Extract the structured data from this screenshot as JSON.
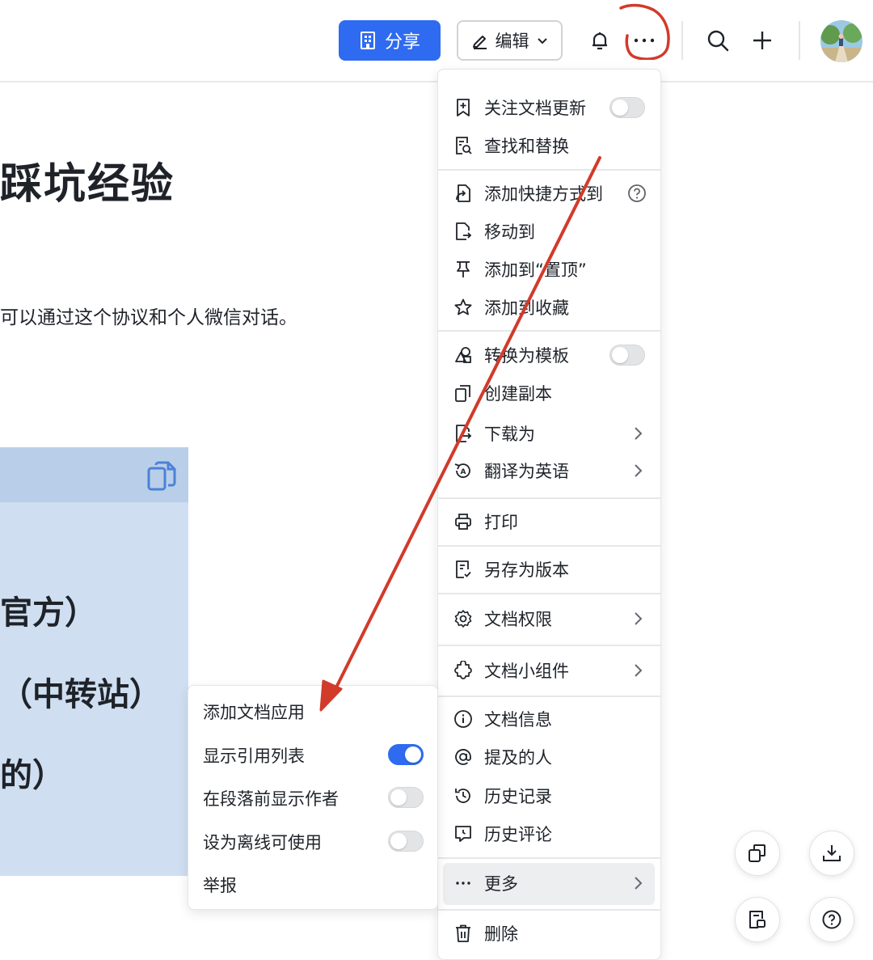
{
  "header": {
    "share_label": "分享",
    "edit_label": "编辑"
  },
  "document": {
    "title": "踩坑经验",
    "paragraph": "可以通过这个协议和个人微信对话。",
    "code_lines": [
      "官方）",
      "（中转站）",
      "的）"
    ]
  },
  "menu": {
    "items": [
      {
        "label": "关注文档更新",
        "icon": "follow-doc-icon",
        "toggle": false
      },
      {
        "label": "查找和替换",
        "icon": "find-replace-icon"
      },
      {
        "label": "添加快捷方式到",
        "icon": "shortcut-icon",
        "help": true
      },
      {
        "label": "移动到",
        "icon": "move-icon"
      },
      {
        "label": "添加到“置顶”",
        "icon": "pin-icon"
      },
      {
        "label": "添加到收藏",
        "icon": "star-icon"
      },
      {
        "label": "转换为模板",
        "icon": "template-icon",
        "toggle": false
      },
      {
        "label": "创建副本",
        "icon": "copy-icon"
      },
      {
        "label": "下载为",
        "icon": "download-as-icon",
        "submenu": true
      },
      {
        "label": "翻译为英语",
        "icon": "translate-icon",
        "submenu": true
      },
      {
        "label": "打印",
        "icon": "print-icon"
      },
      {
        "label": "另存为版本",
        "icon": "save-version-icon"
      },
      {
        "label": "文档权限",
        "icon": "settings-icon",
        "submenu": true
      },
      {
        "label": "文档小组件",
        "icon": "widget-icon",
        "submenu": true
      },
      {
        "label": "文档信息",
        "icon": "info-icon"
      },
      {
        "label": "提及的人",
        "icon": "at-icon"
      },
      {
        "label": "历史记录",
        "icon": "history-icon"
      },
      {
        "label": "历史评论",
        "icon": "comment-history-icon"
      },
      {
        "label": "更多",
        "icon": "ellipsis-icon",
        "submenu": true,
        "highlighted": true
      },
      {
        "label": "删除",
        "icon": "trash-icon"
      }
    ]
  },
  "submenu": {
    "items": [
      {
        "label": "添加文档应用"
      },
      {
        "label": "显示引用列表",
        "toggle": true
      },
      {
        "label": "在段落前显示作者",
        "toggle": false
      },
      {
        "label": "设为离线可使用",
        "toggle": false
      },
      {
        "label": "举报"
      }
    ]
  },
  "colors": {
    "accent": "#2f6bf0",
    "annotation_red": "#d23a2a",
    "code_bg": "#cfdff1"
  }
}
